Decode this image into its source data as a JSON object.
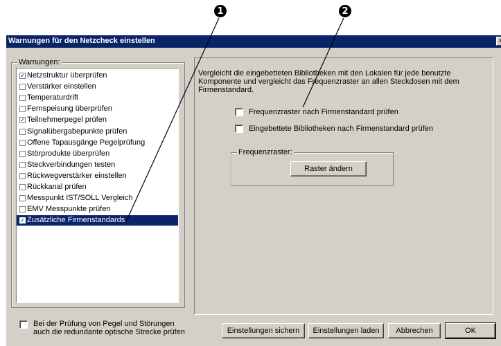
{
  "callouts": [
    "1",
    "2"
  ],
  "dialog": {
    "title": "Warnungen für den Netzcheck einstellen",
    "close_label": "×"
  },
  "warnings": {
    "group_label": "Warnungen:",
    "items": [
      {
        "label": "Netzstruktur überprüfen",
        "checked": true,
        "check_glyph": "✓"
      },
      {
        "label": "Verstärker einstellen",
        "checked": false,
        "check_glyph": ""
      },
      {
        "label": "Temperaturdrift",
        "checked": false,
        "check_glyph": ""
      },
      {
        "label": "Fernspeisung überprüfen",
        "checked": false,
        "check_glyph": ""
      },
      {
        "label": "Teilnehmerpegel prüfen",
        "checked": true,
        "check_glyph": "✓"
      },
      {
        "label": "Signalübergabepunkte prüfen",
        "checked": false,
        "check_glyph": ""
      },
      {
        "label": "Offene Tapausgänge Pegelprüfung",
        "checked": false,
        "check_glyph": ""
      },
      {
        "label": "Störprodukte überprüfen",
        "checked": false,
        "check_glyph": ""
      },
      {
        "label": "Steckverbindungen testen",
        "checked": false,
        "check_glyph": ""
      },
      {
        "label": "Rückwegverstärker einstellen",
        "checked": false,
        "check_glyph": ""
      },
      {
        "label": "Rückkanal prüfen",
        "checked": false,
        "check_glyph": ""
      },
      {
        "label": "Messpunkt IST/SOLL Vergleich",
        "checked": false,
        "check_glyph": ""
      },
      {
        "label": "EMV Messpunkte prüfen",
        "checked": false,
        "check_glyph": ""
      },
      {
        "label": "Zusätzliche Firmenstandards",
        "checked": true,
        "check_glyph": "✓",
        "selected": true
      }
    ]
  },
  "detail": {
    "description": "Vergleicht die eingebetteten Bibliotheken mit den Lokalen für jede benutzte Komponente und vergleicht das Frequenzraster an allen Steckdosen mit dem Firmenstandard.",
    "check_frequenz": "Frequenzraster nach Firmenstandard prüfen",
    "check_bibliotheken": "Eingebettete Bibliotheken nach Firmenstandard prüfen",
    "frequenz_group_label": "Frequenzraster:",
    "raster_button": "Raster ändern"
  },
  "footer": {
    "optical_check_line1": "Bei der Prüfung von Pegel und Störungen",
    "optical_check_line2": "auch die redundante optische Strecke prüfen",
    "save_button": "Einstellungen sichern",
    "load_button": "Einstellungen laden",
    "cancel_button": "Abbrechen",
    "ok_button": "OK"
  }
}
